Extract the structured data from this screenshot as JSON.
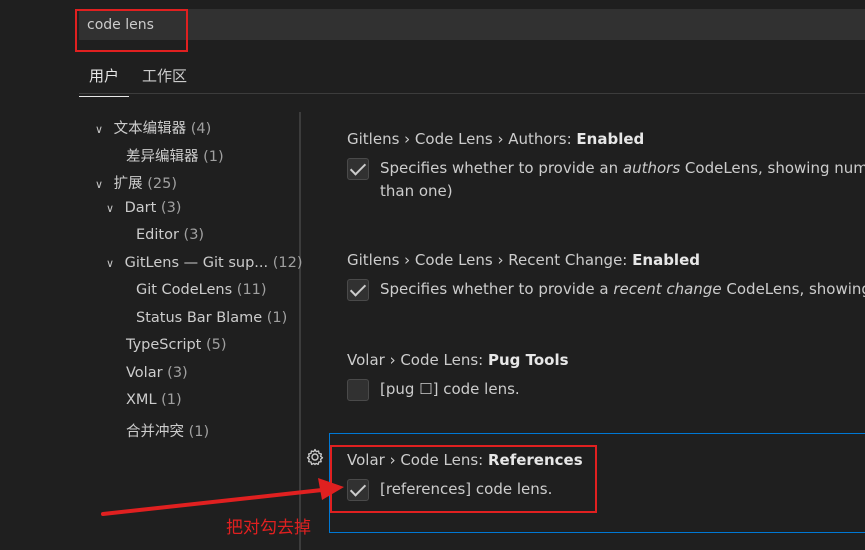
{
  "search": {
    "value": "code lens"
  },
  "tabs": [
    {
      "label": "用户",
      "active": true
    },
    {
      "label": "工作区",
      "active": false
    }
  ],
  "toc": [
    {
      "label": "文本编辑器",
      "count": "(4)",
      "expanded": true
    },
    {
      "label": "差异编辑器",
      "count": "(1)"
    },
    {
      "label": "扩展",
      "count": "(25)",
      "expanded": true
    },
    {
      "label": "Dart",
      "count": "(3)",
      "expanded": true
    },
    {
      "label": "Editor",
      "count": "(3)"
    },
    {
      "label": "GitLens — Git sup...",
      "count": "(12)",
      "expanded": true
    },
    {
      "label": "Git CodeLens",
      "count": "(11)"
    },
    {
      "label": "Status Bar Blame",
      "count": "(1)"
    },
    {
      "label": "TypeScript",
      "count": "(5)"
    },
    {
      "label": "Volar",
      "count": "(3)"
    },
    {
      "label": "XML",
      "count": "(1)"
    },
    {
      "label": "合并冲突",
      "count": "(1)"
    }
  ],
  "settings": [
    {
      "prefix": "Gitlens › Code Lens › Authors: ",
      "name": "Enabled",
      "checked": true,
      "desc_before": "Specifies whether to provide an ",
      "desc_em": "authors",
      "desc_after": " CodeLens, showing number",
      "desc_line2": "than one)"
    },
    {
      "prefix": "Gitlens › Code Lens › Recent Change: ",
      "name": "Enabled",
      "checked": true,
      "desc_before": "Specifies whether to provide a ",
      "desc_em": "recent change",
      "desc_after": " CodeLens, showing the"
    },
    {
      "prefix": "Volar › Code Lens: ",
      "name": "Pug Tools",
      "checked": false,
      "desc": "[pug ☐] code lens."
    },
    {
      "prefix": "Volar › Code Lens: ",
      "name": "References",
      "checked": true,
      "desc": "[references] code lens."
    }
  ],
  "annotation": {
    "text": "把对勾去掉",
    "color": "#e02020"
  },
  "colors": {
    "background": "#1f1f1f",
    "focus_border": "#0078d4"
  }
}
